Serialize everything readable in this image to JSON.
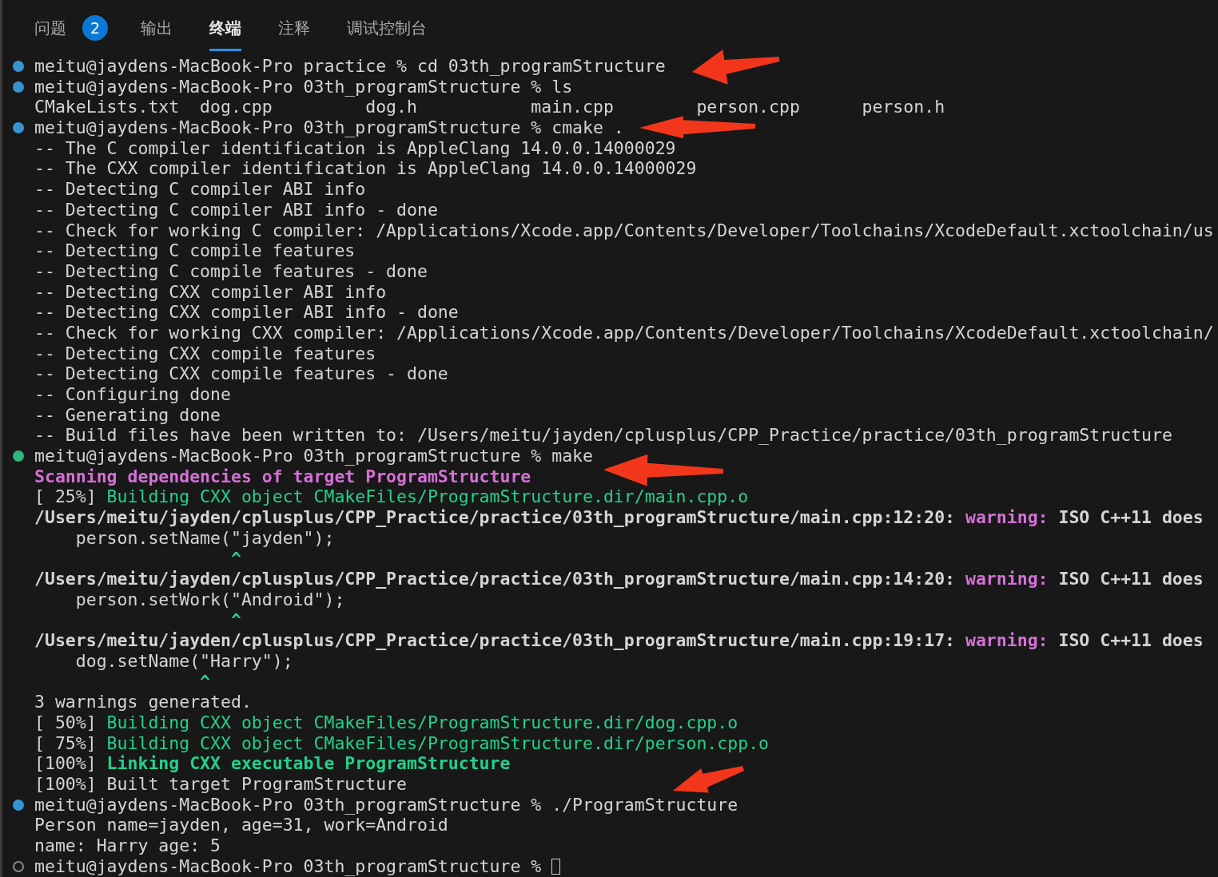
{
  "tabs": [
    {
      "label": "问题",
      "selected": false,
      "badge": "2"
    },
    {
      "label": "输出",
      "selected": false
    },
    {
      "label": "终端",
      "selected": true
    },
    {
      "label": "注释",
      "selected": false
    },
    {
      "label": "调试控制台",
      "selected": false
    }
  ],
  "terminal": {
    "lines": [
      {
        "kind": "command",
        "finished": true,
        "color": "#3794d1",
        "segments": [
          {
            "kind": "plain",
            "text": "meitu@jaydens-MacBook-Pro practice % cd 03th_programStructure"
          }
        ]
      },
      {
        "kind": "command",
        "finished": true,
        "color": "#3794d1",
        "segments": [
          {
            "kind": "plain",
            "text": "meitu@jaydens-MacBook-Pro 03th_programStructure % ls"
          }
        ]
      },
      {
        "kind": "output",
        "segments": [
          {
            "kind": "plain",
            "text": "CMakeLists.txt  dog.cpp         dog.h           main.cpp        person.cpp      person.h"
          }
        ]
      },
      {
        "kind": "command",
        "finished": true,
        "color": "#3794d1",
        "segments": [
          {
            "kind": "plain",
            "text": "meitu@jaydens-MacBook-Pro 03th_programStructure % cmake ."
          }
        ]
      },
      {
        "kind": "output",
        "segments": [
          {
            "kind": "plain",
            "text": "-- The C compiler identification is AppleClang 14.0.0.14000029"
          }
        ]
      },
      {
        "kind": "output",
        "segments": [
          {
            "kind": "plain",
            "text": "-- The CXX compiler identification is AppleClang 14.0.0.14000029"
          }
        ]
      },
      {
        "kind": "output",
        "segments": [
          {
            "kind": "plain",
            "text": "-- Detecting C compiler ABI info"
          }
        ]
      },
      {
        "kind": "output",
        "segments": [
          {
            "kind": "plain",
            "text": "-- Detecting C compiler ABI info - done"
          }
        ]
      },
      {
        "kind": "output",
        "segments": [
          {
            "kind": "plain",
            "text": "-- Check for working C compiler: /Applications/Xcode.app/Contents/Developer/Toolchains/XcodeDefault.xctoolchain/us"
          }
        ]
      },
      {
        "kind": "output",
        "segments": [
          {
            "kind": "plain",
            "text": "-- Detecting C compile features"
          }
        ]
      },
      {
        "kind": "output",
        "segments": [
          {
            "kind": "plain",
            "text": "-- Detecting C compile features - done"
          }
        ]
      },
      {
        "kind": "output",
        "segments": [
          {
            "kind": "plain",
            "text": "-- Detecting CXX compiler ABI info"
          }
        ]
      },
      {
        "kind": "output",
        "segments": [
          {
            "kind": "plain",
            "text": "-- Detecting CXX compiler ABI info - done"
          }
        ]
      },
      {
        "kind": "output",
        "segments": [
          {
            "kind": "plain",
            "text": "-- Check for working CXX compiler: /Applications/Xcode.app/Contents/Developer/Toolchains/XcodeDefault.xctoolchain/"
          }
        ]
      },
      {
        "kind": "output",
        "segments": [
          {
            "kind": "plain",
            "text": "-- Detecting CXX compile features"
          }
        ]
      },
      {
        "kind": "output",
        "segments": [
          {
            "kind": "plain",
            "text": "-- Detecting CXX compile features - done"
          }
        ]
      },
      {
        "kind": "output",
        "segments": [
          {
            "kind": "plain",
            "text": "-- Configuring done"
          }
        ]
      },
      {
        "kind": "output",
        "segments": [
          {
            "kind": "plain",
            "text": "-- Generating done"
          }
        ]
      },
      {
        "kind": "output",
        "segments": [
          {
            "kind": "plain",
            "text": "-- Build files have been written to: /Users/meitu/jayden/cplusplus/CPP_Practice/practice/03th_programStructure"
          }
        ]
      },
      {
        "kind": "command",
        "finished": true,
        "color": "#2eb67d",
        "segments": [
          {
            "kind": "plain",
            "text": "meitu@jaydens-MacBook-Pro 03th_programStructure % make"
          }
        ]
      },
      {
        "kind": "output",
        "segments": [
          {
            "kind": "magenta-bold",
            "text": "Scanning dependencies of target ProgramStructure"
          }
        ]
      },
      {
        "kind": "output",
        "segments": [
          {
            "kind": "plain",
            "text": "[ 25%] "
          },
          {
            "kind": "green",
            "text": "Building CXX object CMakeFiles/ProgramStructure.dir/main.cpp.o"
          }
        ]
      },
      {
        "kind": "output",
        "segments": [
          {
            "kind": "bold",
            "text": "/Users/meitu/jayden/cplusplus/CPP_Practice/practice/03th_programStructure/main.cpp:12:20: "
          },
          {
            "kind": "magenta-bold",
            "text": "warning:"
          },
          {
            "kind": "bold",
            "text": " ISO C++11 does"
          }
        ]
      },
      {
        "kind": "output",
        "segments": [
          {
            "kind": "plain",
            "text": "    person.setName(\"jayden\");"
          }
        ]
      },
      {
        "kind": "output",
        "segments": [
          {
            "kind": "green-bold",
            "text": "                   ^"
          }
        ]
      },
      {
        "kind": "output",
        "segments": [
          {
            "kind": "bold",
            "text": "/Users/meitu/jayden/cplusplus/CPP_Practice/practice/03th_programStructure/main.cpp:14:20: "
          },
          {
            "kind": "magenta-bold",
            "text": "warning:"
          },
          {
            "kind": "bold",
            "text": " ISO C++11 does"
          }
        ]
      },
      {
        "kind": "output",
        "segments": [
          {
            "kind": "plain",
            "text": "    person.setWork(\"Android\");"
          }
        ]
      },
      {
        "kind": "output",
        "segments": [
          {
            "kind": "green-bold",
            "text": "                   ^"
          }
        ]
      },
      {
        "kind": "output",
        "segments": [
          {
            "kind": "bold",
            "text": "/Users/meitu/jayden/cplusplus/CPP_Practice/practice/03th_programStructure/main.cpp:19:17: "
          },
          {
            "kind": "magenta-bold",
            "text": "warning:"
          },
          {
            "kind": "bold",
            "text": " ISO C++11 does"
          }
        ]
      },
      {
        "kind": "output",
        "segments": [
          {
            "kind": "plain",
            "text": "    dog.setName(\"Harry\");"
          }
        ]
      },
      {
        "kind": "output",
        "segments": [
          {
            "kind": "green-bold",
            "text": "                ^"
          }
        ]
      },
      {
        "kind": "output",
        "segments": [
          {
            "kind": "plain",
            "text": "3 warnings generated."
          }
        ]
      },
      {
        "kind": "output",
        "segments": [
          {
            "kind": "plain",
            "text": "[ 50%] "
          },
          {
            "kind": "green",
            "text": "Building CXX object CMakeFiles/ProgramStructure.dir/dog.cpp.o"
          }
        ]
      },
      {
        "kind": "output",
        "segments": [
          {
            "kind": "plain",
            "text": "[ 75%] "
          },
          {
            "kind": "green",
            "text": "Building CXX object CMakeFiles/ProgramStructure.dir/person.cpp.o"
          }
        ]
      },
      {
        "kind": "output",
        "segments": [
          {
            "kind": "plain",
            "text": "[100%] "
          },
          {
            "kind": "green-bold",
            "text": "Linking CXX executable ProgramStructure"
          }
        ]
      },
      {
        "kind": "output",
        "segments": [
          {
            "kind": "plain",
            "text": "[100%] Built target ProgramStructure"
          }
        ]
      },
      {
        "kind": "command",
        "finished": true,
        "color": "#3794d1",
        "segments": [
          {
            "kind": "plain",
            "text": "meitu@jaydens-MacBook-Pro 03th_programStructure % ./ProgramStructure"
          }
        ]
      },
      {
        "kind": "output",
        "segments": [
          {
            "kind": "plain",
            "text": "Person name=jayden, age=31, work=Android"
          }
        ]
      },
      {
        "kind": "output",
        "segments": [
          {
            "kind": "plain",
            "text": "name: Harry age: 5"
          }
        ]
      },
      {
        "kind": "command",
        "finished": false,
        "cursor": true,
        "segments": [
          {
            "kind": "plain",
            "text": "meitu@jaydens-MacBook-Pro 03th_programStructure % "
          }
        ]
      }
    ]
  }
}
